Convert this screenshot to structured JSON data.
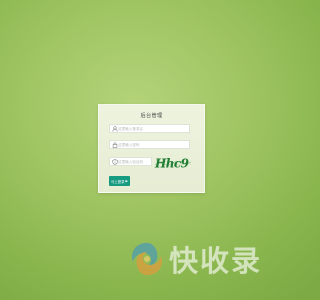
{
  "login": {
    "title": "后台管理",
    "username": {
      "value": "",
      "placeholder": "这里输入登录名",
      "icon": "user-icon"
    },
    "password": {
      "value": "",
      "placeholder": "这里输入密码",
      "icon": "lock-icon"
    },
    "captcha": {
      "value": "",
      "placeholder": "这里输入验证码",
      "icon": "shield-icon",
      "image_text": "Hhc9"
    },
    "submit_label": "马上登录",
    "submit_icon": "arrow-right-icon",
    "accent_color": "#169a80"
  },
  "watermark": {
    "text": "快收录",
    "logo": "swirl-logo"
  }
}
